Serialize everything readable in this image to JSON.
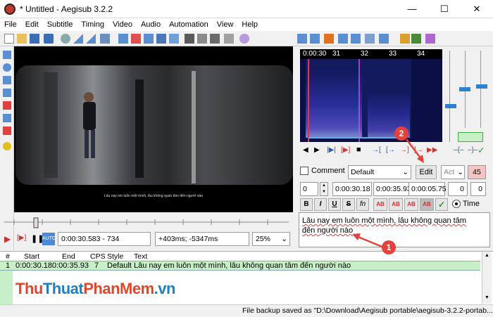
{
  "window": {
    "title": "* Untitled - Aegisub 3.2.2",
    "minimize": "—",
    "maximize": "☐",
    "close": "✕"
  },
  "menu": [
    "File",
    "Edit",
    "Subtitle",
    "Timing",
    "Video",
    "Audio",
    "Automation",
    "View",
    "Help"
  ],
  "video": {
    "subtitle_overlay": "Lâu nay em luôn một mình, lâu không quan tâm đến người nào",
    "time_frame": "0:00:30.583 - 734",
    "offset": "+403ms; -5347ms",
    "zoom": "25%"
  },
  "audio": {
    "timecode": "0:00:30",
    "ticks": [
      "31",
      "32",
      "33",
      "34"
    ]
  },
  "edit": {
    "comment_label": "Comment",
    "style": "Default",
    "edit_button": "Edit",
    "actor_placeholder": "Act",
    "char_count": "45",
    "layer": "0",
    "start": "0:00:30.18",
    "end": "0:00:35.93",
    "duration": "0:00:05.75",
    "margin_l": "0",
    "margin_r": "0",
    "bold": "B",
    "italic": "I",
    "underline": "U",
    "strike": "S",
    "fn": "fn",
    "ab1": "AB",
    "ab2": "AB",
    "ab3": "AB",
    "ab4": "AB",
    "time_label": "Time",
    "text_line1": "Lâu nay em luôn một mình, lâu không quan tâm",
    "text_line2": "đến người nào"
  },
  "grid": {
    "headers": [
      "#",
      "Start",
      "End",
      "CPS",
      "Style",
      "Text"
    ],
    "rows": [
      {
        "num": "1",
        "start": "0:00:30.18",
        "end": "0:00:35.93",
        "cps": "7",
        "style": "Default",
        "text": "Lâu nay em luôn một mình, lâu không quan tâm đến người nào"
      }
    ]
  },
  "status": "File backup saved as \"D:\\Download\\Aegisub portable\\aegisub-3.2.2-portab...",
  "watermark": {
    "part1": "Thu",
    "part2": "Thuat",
    "part3": "PhanMem",
    "part4": ".vn"
  },
  "annotations": {
    "badge1": "1",
    "badge2": "2"
  },
  "colors": {
    "accent_green": "#c7f0c7",
    "arrow_red": "#e2423a",
    "char_count_bg": "#f4c4c4",
    "spectrum_bg": "#0b0f45"
  }
}
